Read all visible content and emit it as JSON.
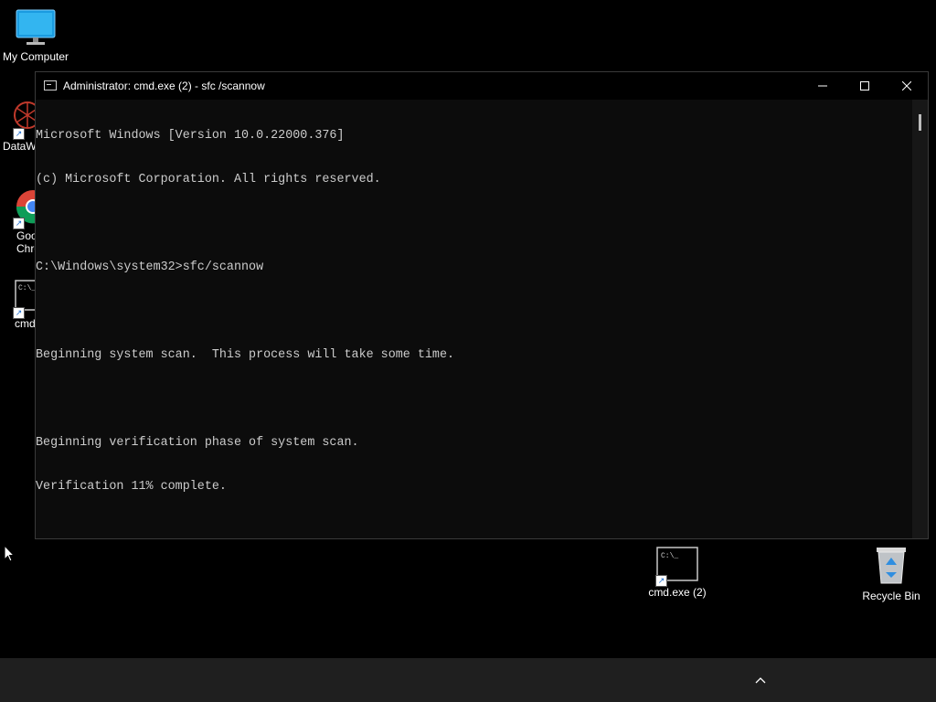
{
  "desktop": {
    "icons": [
      {
        "label": "My Computer"
      },
      {
        "label": "DataW"
      },
      {
        "label": "Goo\nChro"
      },
      {
        "label": "cmd"
      },
      {
        "label": "cmd.exe (2)"
      },
      {
        "label": "Recycle Bin"
      }
    ]
  },
  "cmd_window": {
    "title": "Administrator: cmd.exe (2) - sfc /scannow",
    "console_lines": [
      "Microsoft Windows [Version 10.0.22000.376]",
      "(c) Microsoft Corporation. All rights reserved.",
      "",
      "C:\\Windows\\system32>sfc/scannow",
      "",
      "Beginning system scan.  This process will take some time.",
      "",
      "Beginning verification phase of system scan.",
      "Verification 11% complete."
    ]
  },
  "colors": {
    "desktop_bg": "#000000",
    "console_bg": "#0c0c0c",
    "console_text": "#cccccc",
    "taskbar_bg": "#1f1f1f"
  },
  "icons": {
    "minimize": "minimize-icon",
    "maximize": "maximize-icon",
    "close": "close-icon",
    "tray": "chevron-up-icon"
  }
}
